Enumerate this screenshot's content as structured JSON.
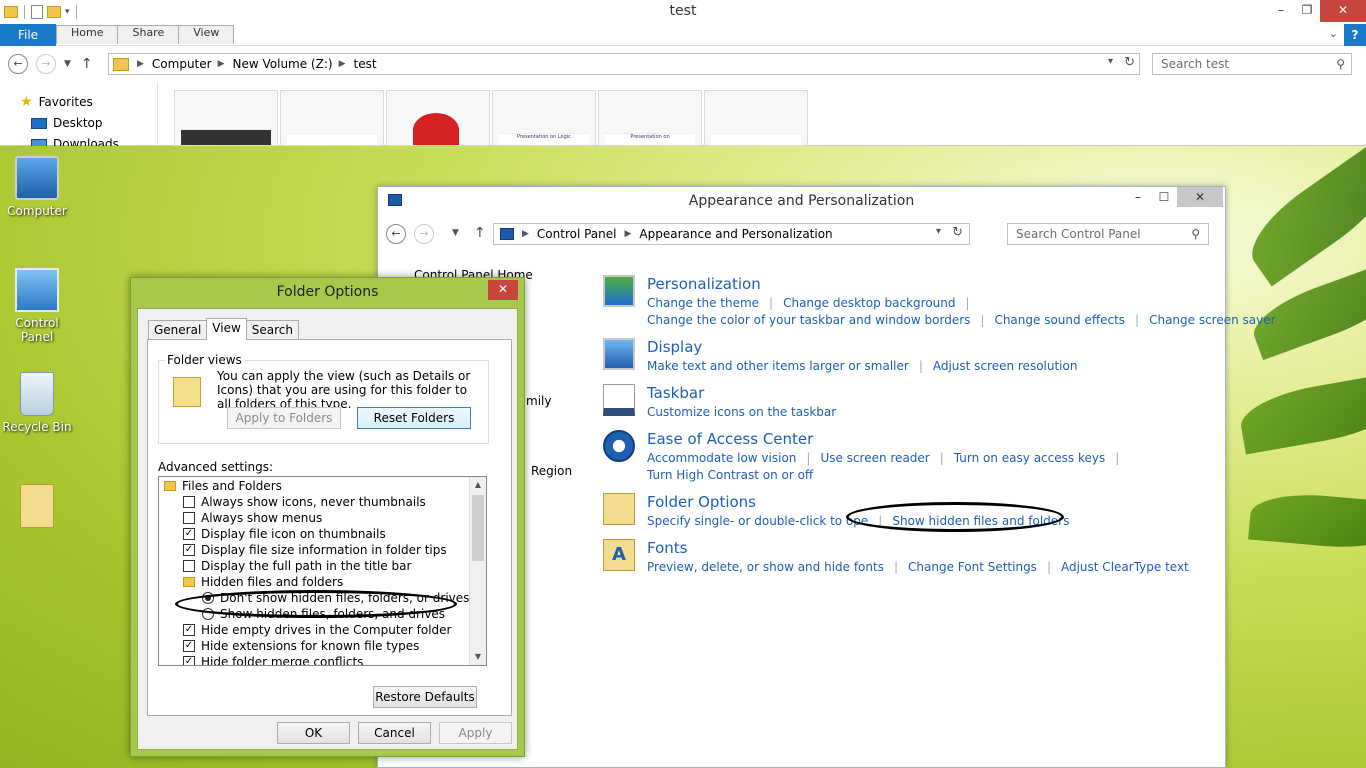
{
  "explorer": {
    "title": "test",
    "ribbon_tabs": [
      "File",
      "Home",
      "Share",
      "View"
    ],
    "address": [
      "Computer",
      "New Volume (Z:)",
      "test"
    ],
    "search_placeholder": "Search test",
    "nav": {
      "favorites": "Favorites",
      "desktop": "Desktop",
      "downloads": "Downloads"
    },
    "thumbnail_captions": [
      "Presentation on Logic",
      "Presentation on"
    ]
  },
  "desktop": {
    "icons": [
      "Computer",
      "Control Panel",
      "Recycle Bin"
    ]
  },
  "control_panel": {
    "title": "Appearance and Personalization",
    "address": [
      "Control Panel",
      "Appearance and Personalization"
    ],
    "search_placeholder": "Search Control Panel",
    "left_links": [
      "Control Panel Home",
      "mily",
      "Region"
    ],
    "categories": [
      {
        "name": "Personalization",
        "icon": "personalization-icon",
        "links": [
          [
            "Change the theme",
            "Change desktop background"
          ],
          [
            "Change the color of your taskbar and window borders",
            "Change sound effects",
            "Change screen saver"
          ]
        ]
      },
      {
        "name": "Display",
        "icon": "display-icon",
        "links": [
          [
            "Make text and other items larger or smaller",
            "Adjust screen resolution"
          ]
        ]
      },
      {
        "name": "Taskbar",
        "icon": "taskbar-icon",
        "links": [
          [
            "Customize icons on the taskbar"
          ]
        ]
      },
      {
        "name": "Ease of Access Center",
        "icon": "ease-of-access-icon",
        "links": [
          [
            "Accommodate low vision",
            "Use screen reader",
            "Turn on easy access keys"
          ],
          [
            "Turn High Contrast on or off"
          ]
        ]
      },
      {
        "name": "Folder Options",
        "icon": "folder-options-icon",
        "links": [
          [
            "Specify single- or double-click to ope",
            "Show hidden files and folders"
          ]
        ]
      },
      {
        "name": "Fonts",
        "icon": "fonts-icon",
        "links": [
          [
            "Preview, delete, or show and hide fonts",
            "Change Font Settings",
            "Adjust ClearType text"
          ]
        ]
      }
    ]
  },
  "folder_options": {
    "title": "Folder Options",
    "tabs": [
      "General",
      "View",
      "Search"
    ],
    "active_tab": "View",
    "folder_views_label": "Folder views",
    "folder_views_text": "You can apply the view (such as Details or Icons) that you are using for this folder to all folders of this type.",
    "apply_to_folders": "Apply to Folders",
    "reset_folders": "Reset Folders",
    "advanced_label": "Advanced settings:",
    "settings": [
      {
        "type": "folder",
        "label": "Files and Folders",
        "indent": 0
      },
      {
        "type": "check",
        "label": "Always show icons, never thumbnails",
        "checked": false,
        "indent": 1
      },
      {
        "type": "check",
        "label": "Always show menus",
        "checked": false,
        "indent": 1
      },
      {
        "type": "check",
        "label": "Display file icon on thumbnails",
        "checked": true,
        "indent": 1
      },
      {
        "type": "check",
        "label": "Display file size information in folder tips",
        "checked": true,
        "indent": 1
      },
      {
        "type": "check",
        "label": "Display the full path in the title bar",
        "checked": false,
        "indent": 1
      },
      {
        "type": "folder",
        "label": "Hidden files and folders",
        "indent": 1
      },
      {
        "type": "radio",
        "label": "Don't show hidden files, folders, or drives",
        "checked": true,
        "indent": 2
      },
      {
        "type": "radio",
        "label": "Show hidden files, folders, and drives",
        "checked": false,
        "indent": 2
      },
      {
        "type": "check",
        "label": "Hide empty drives in the Computer folder",
        "checked": true,
        "indent": 1
      },
      {
        "type": "check",
        "label": "Hide extensions for known file types",
        "checked": true,
        "indent": 1
      },
      {
        "type": "check",
        "label": "Hide folder merge conflicts",
        "checked": true,
        "indent": 1
      }
    ],
    "restore_defaults": "Restore Defaults",
    "ok": "OK",
    "cancel": "Cancel",
    "apply": "Apply"
  }
}
